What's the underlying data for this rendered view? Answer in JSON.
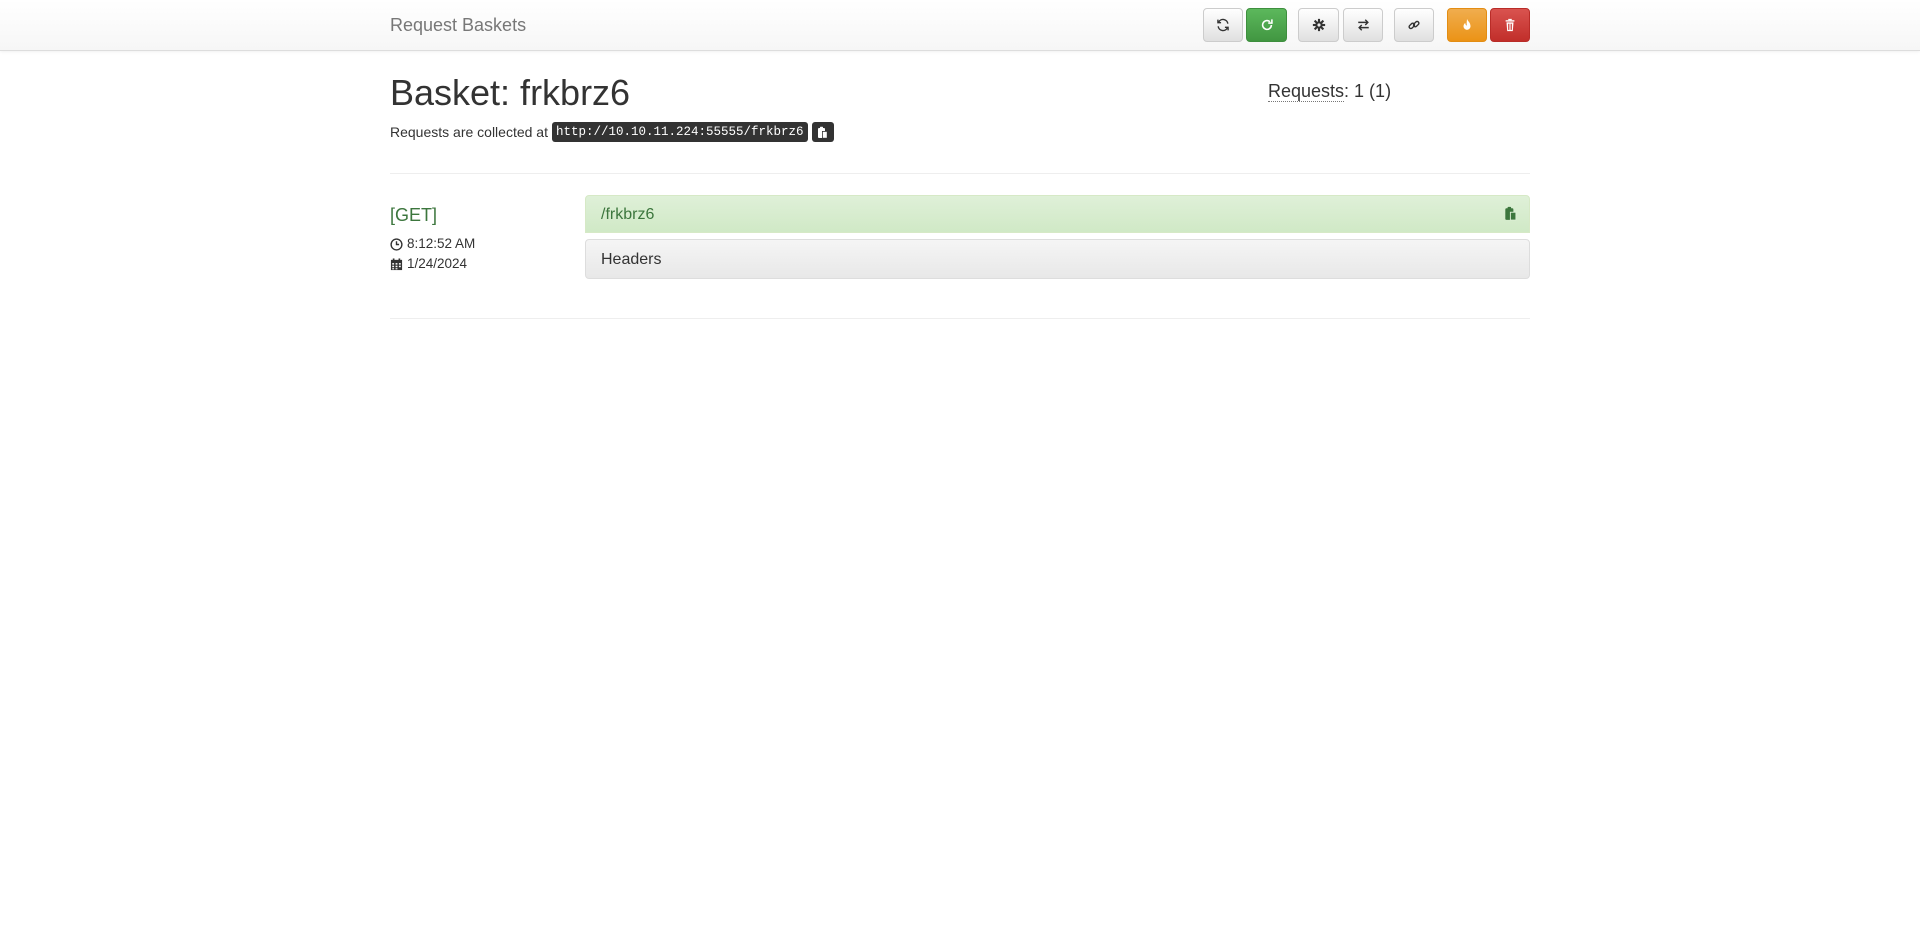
{
  "navbar": {
    "brand": "Request Baskets",
    "buttons": [
      {
        "name": "refresh-button",
        "icon": "refresh-icon",
        "style": "default"
      },
      {
        "name": "auto-refresh-button",
        "icon": "auto-refresh-icon",
        "style": "success"
      },
      {
        "name": "settings-button",
        "icon": "gear-icon",
        "style": "default"
      },
      {
        "name": "responses-button",
        "icon": "transfer-icon",
        "style": "default"
      },
      {
        "name": "share-link-button",
        "icon": "link-icon",
        "style": "default"
      },
      {
        "name": "clear-button",
        "icon": "fire-icon",
        "style": "warning"
      },
      {
        "name": "delete-button",
        "icon": "trash-icon",
        "style": "danger"
      }
    ]
  },
  "basket": {
    "title": "Basket: frkbrz6",
    "collected_prefix": "Requests are collected at",
    "url": "http://10.10.11.224:55555/frkbrz6",
    "requests_label": "Requests",
    "requests_value": ": 1 (1)"
  },
  "requests": [
    {
      "method": "[GET]",
      "time": "8:12:52 AM",
      "date": "1/24/2024",
      "path": "/frkbrz6",
      "headers_label": "Headers"
    }
  ],
  "colors": {
    "success": "#5cb85c",
    "warning": "#f0ad4e",
    "danger": "#d9534f",
    "method_text": "#3c763d",
    "panel_success_bg": "#dff0d8"
  }
}
